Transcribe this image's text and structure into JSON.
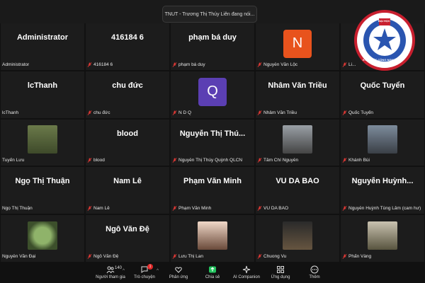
{
  "banner_text": "TNUT - Trương Thị Thúy Liên đang nói...",
  "tiles": [
    {
      "big": "Administrator",
      "label": "Administrator",
      "muted": false
    },
    {
      "big": "416184 6",
      "label": "416184 6",
      "muted": true
    },
    {
      "big": "phạm bá duy",
      "label": "phạm bá duy",
      "muted": true
    },
    {
      "big": "",
      "label": "Nguyễn Văn Lộc",
      "muted": true,
      "avatar": "N",
      "avatar_color": "#e8531d"
    },
    {
      "big": "",
      "label": "Li...",
      "muted": true
    },
    {
      "big": "lcThanh",
      "label": "lcThanh",
      "muted": false
    },
    {
      "big": "chu đức",
      "label": "chu đức",
      "muted": true
    },
    {
      "big": "",
      "label": "N D Q",
      "muted": true,
      "avatar": "Q",
      "avatar_color": "#5b3fb3"
    },
    {
      "big": "Nhâm Văn Triều",
      "label": "Nhâm Văn Triều",
      "muted": true
    },
    {
      "big": "Quốc Tuyển",
      "label": "Quốc Tuyển",
      "muted": true
    },
    {
      "big": "",
      "label": "Tuyến Lưu",
      "muted": false,
      "photo": "p1"
    },
    {
      "big": "blood",
      "label": "blood",
      "muted": true
    },
    {
      "big": "Nguyễn Thị Thú...",
      "label": "Nguyễn Thị Thúy Quỳnh QLCN",
      "muted": true
    },
    {
      "big": "",
      "label": "Tâm Chí Nguyễn",
      "muted": true,
      "photo": "p2"
    },
    {
      "big": "",
      "label": "Khánh Bùi",
      "muted": true,
      "photo": "p3"
    },
    {
      "big": "Ngọ Thị Thuận",
      "label": "Ngọ Thị Thuận",
      "muted": false
    },
    {
      "big": "Nam Lê",
      "label": "Nam Lê",
      "muted": true
    },
    {
      "big": "Phạm Văn Minh",
      "label": "Phạm Văn Minh",
      "muted": true
    },
    {
      "big": "VU DA BAO",
      "label": "VU DA BAO",
      "muted": true
    },
    {
      "big": "Nguyễn Huỳnh...",
      "label": "Nguyễn Huỳnh Tùng Lâm (cam hư)",
      "muted": true
    },
    {
      "big": "",
      "label": "Nguyễn Văn Đại",
      "muted": false,
      "photo": "p4"
    },
    {
      "big": "Ngô Văn Đệ",
      "label": "Ngô Văn Đệ",
      "muted": true
    },
    {
      "big": "",
      "label": "Lưu Thị Lan",
      "muted": true,
      "photo": "p5"
    },
    {
      "big": "",
      "label": "Chuong Vu",
      "muted": true,
      "photo": "p6"
    },
    {
      "big": "",
      "label": "Phấn Vàng",
      "muted": true,
      "photo": "p7"
    }
  ],
  "logo": {
    "top": "ĐẠI HỌC",
    "ring": "KỸ THUẬT CÔNG NGHIỆP"
  },
  "toolbar": {
    "participants_label": "Người tham gia",
    "participants_count": "140",
    "chat_label": "Trò chuyện",
    "chat_badge": "1",
    "react_label": "Phản ứng",
    "share_label": "Chia sẻ",
    "ai_label": "AI Companion",
    "apps_label": "Ứng dụng",
    "more_label": "Thêm"
  },
  "colors": {
    "muted": "#e53935",
    "share": "#22c55e",
    "badge": "#e02828"
  }
}
